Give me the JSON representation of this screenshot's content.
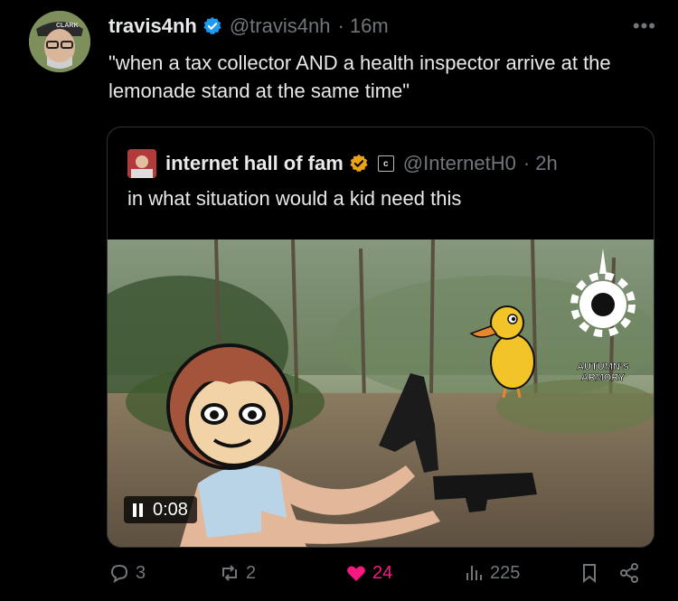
{
  "tweet": {
    "display_name": "travis4nh",
    "handle": "@travis4nh",
    "time": "· 16m",
    "more_icon": "ellipsis-icon",
    "text": "\"when a tax collector AND a health inspector arrive at the lemonade stand at the same time\"",
    "verified_color": "#1d9bf0"
  },
  "quoted": {
    "display_name": "internet hall of fam",
    "badge_letter": "c",
    "handle": "@InternetH0",
    "time": "· 2h",
    "text": "in what situation would a kid need this",
    "verified_color": "#e8a317",
    "watermark": "AUTUMN'S ARMORY",
    "video_time": "0:08"
  },
  "actions": {
    "replies": "3",
    "reposts": "2",
    "likes": "24",
    "views": "225",
    "like_color": "#f91880"
  }
}
